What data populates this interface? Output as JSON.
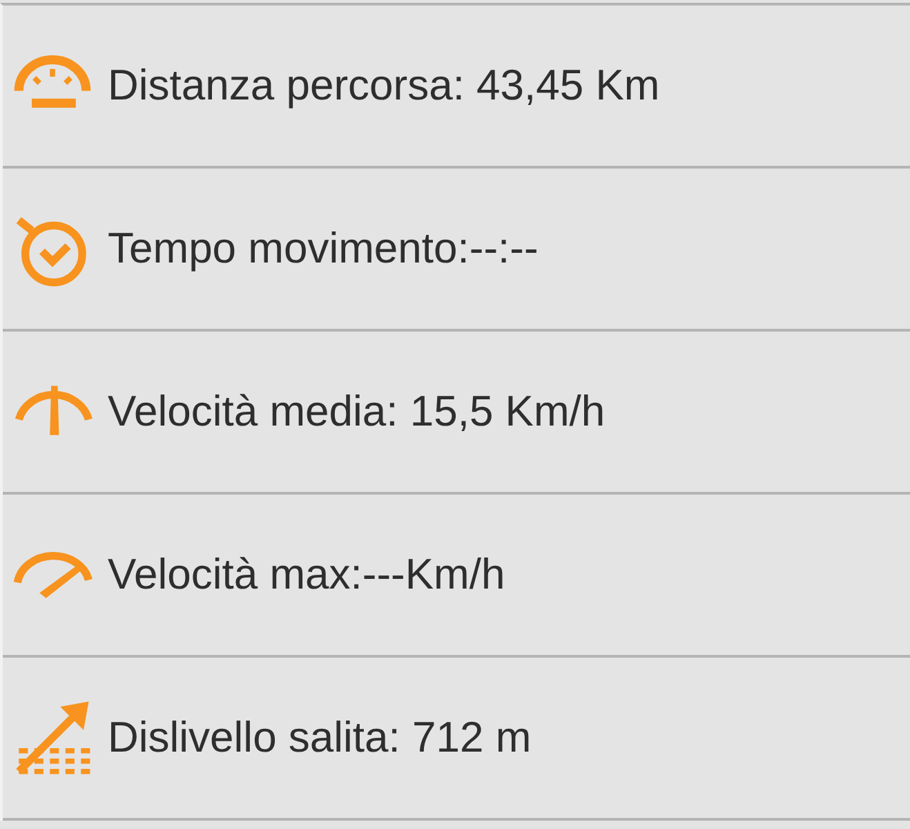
{
  "stats": [
    {
      "kind": "distance",
      "label": "Distanza percorsa: 43,45 Km"
    },
    {
      "kind": "time",
      "label": "Tempo movimento:--:--"
    },
    {
      "kind": "avg_speed",
      "label": "Velocità media: 15,5 Km/h"
    },
    {
      "kind": "max_speed",
      "label": "Velocità max:---Km/h"
    },
    {
      "kind": "climb",
      "label": "Dislivello salita: 712 m"
    }
  ]
}
